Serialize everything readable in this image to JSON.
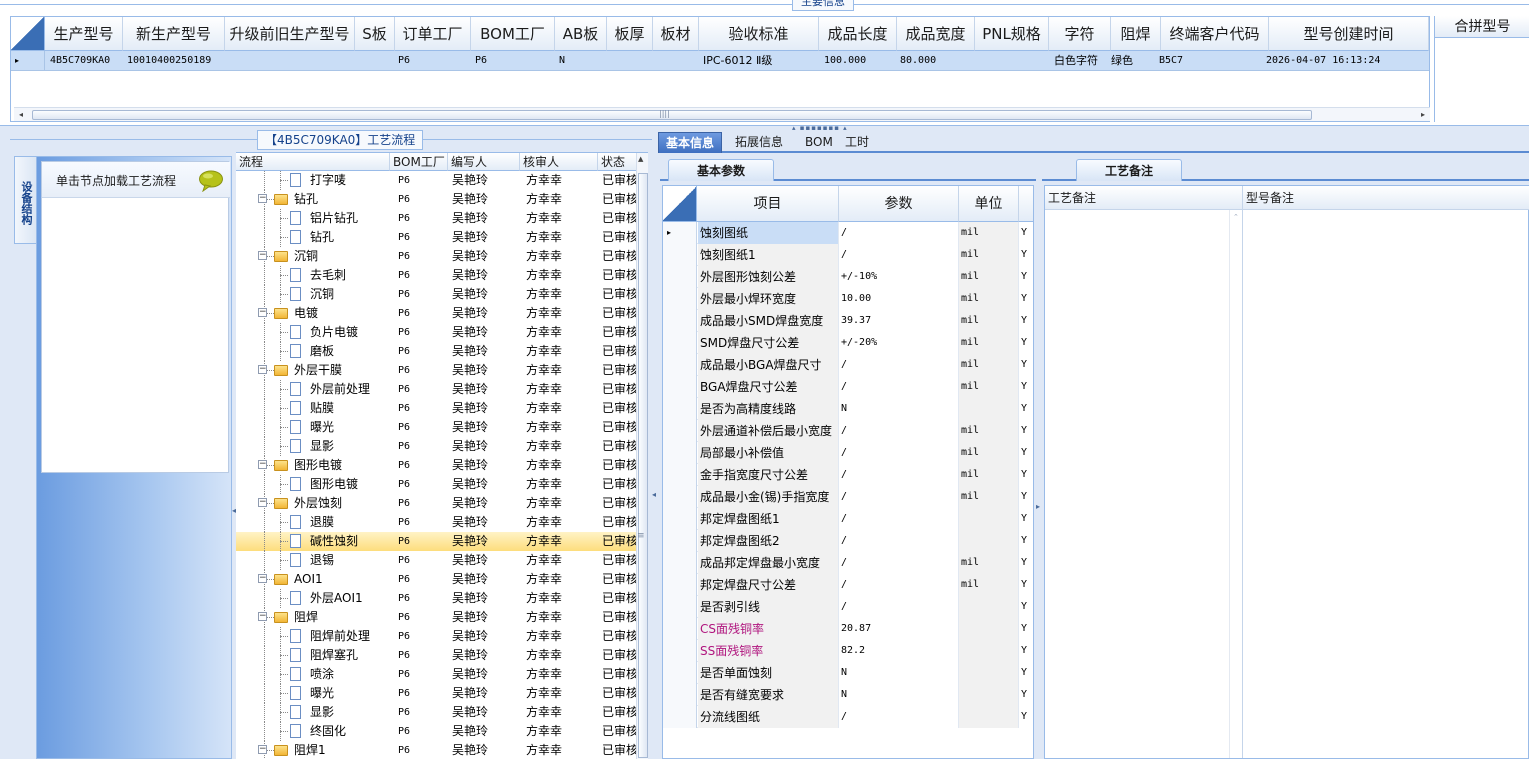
{
  "top": {
    "caption": "主要信息",
    "columns": [
      "生产型号",
      "新生产型号",
      "升级前旧生产型号",
      "S板",
      "订单工厂",
      "BOM工厂",
      "AB板",
      "板厚",
      "板材",
      "验收标准",
      "成品长度",
      "成品宽度",
      "PNL规格",
      "字符",
      "阻焊",
      "终端客户代码",
      "型号创建时间"
    ],
    "row": {
      "pointer": "▸",
      "model_no": "4B5C709KA0",
      "new_model_no": "10010400250189",
      "order_factory": "P6",
      "bom_factory": "P6",
      "ab_board": "N",
      "standard": "IPC-6012 Ⅱ级",
      "length": "100.000",
      "width": "80.000",
      "character": "白色字符",
      "solder_mask": "绿色",
      "customer_code": "B5C7",
      "created": "2026-04-07 16:13:24"
    },
    "combo_title": "合拼型号",
    "scroll_left": "◂",
    "scroll_right": "▸",
    "grip": "||||"
  },
  "splitter_grip": "▴ ▪▪▪▪▪▪▪ ▴",
  "left": {
    "process_title": "【4B5C709KA0】工艺流程",
    "vertical_tab": "设备结构",
    "node_hint": "单击节点加载工艺流程",
    "tree_columns": [
      "流程",
      "BOM工厂",
      "编写人",
      "核审人",
      "状态"
    ],
    "tree": [
      {
        "label": "打字唛",
        "level": 1,
        "kind": "file",
        "factory": "P6",
        "writer": "吴艳玲",
        "reviewer": "方幸幸",
        "status": "已审核"
      },
      {
        "label": "钻孔",
        "level": 0,
        "kind": "folder",
        "factory": "P6",
        "writer": "吴艳玲",
        "reviewer": "方幸幸",
        "status": "已审核"
      },
      {
        "label": "铝片钻孔",
        "level": 1,
        "kind": "file",
        "factory": "P6",
        "writer": "吴艳玲",
        "reviewer": "方幸幸",
        "status": "已审核"
      },
      {
        "label": "钻孔",
        "level": 1,
        "kind": "file",
        "factory": "P6",
        "writer": "吴艳玲",
        "reviewer": "方幸幸",
        "status": "已审核"
      },
      {
        "label": "沉铜",
        "level": 0,
        "kind": "folder",
        "factory": "P6",
        "writer": "吴艳玲",
        "reviewer": "方幸幸",
        "status": "已审核"
      },
      {
        "label": "去毛刺",
        "level": 1,
        "kind": "file",
        "factory": "P6",
        "writer": "吴艳玲",
        "reviewer": "方幸幸",
        "status": "已审核"
      },
      {
        "label": "沉铜",
        "level": 1,
        "kind": "file",
        "factory": "P6",
        "writer": "吴艳玲",
        "reviewer": "方幸幸",
        "status": "已审核"
      },
      {
        "label": "电镀",
        "level": 0,
        "kind": "folder",
        "factory": "P6",
        "writer": "吴艳玲",
        "reviewer": "方幸幸",
        "status": "已审核"
      },
      {
        "label": "负片电镀",
        "level": 1,
        "kind": "file",
        "factory": "P6",
        "writer": "吴艳玲",
        "reviewer": "方幸幸",
        "status": "已审核"
      },
      {
        "label": "磨板",
        "level": 1,
        "kind": "file",
        "factory": "P6",
        "writer": "吴艳玲",
        "reviewer": "方幸幸",
        "status": "已审核"
      },
      {
        "label": "外层干膜",
        "level": 0,
        "kind": "folder",
        "factory": "P6",
        "writer": "吴艳玲",
        "reviewer": "方幸幸",
        "status": "已审核"
      },
      {
        "label": "外层前处理",
        "level": 1,
        "kind": "file",
        "factory": "P6",
        "writer": "吴艳玲",
        "reviewer": "方幸幸",
        "status": "已审核"
      },
      {
        "label": "贴膜",
        "level": 1,
        "kind": "file",
        "factory": "P6",
        "writer": "吴艳玲",
        "reviewer": "方幸幸",
        "status": "已审核"
      },
      {
        "label": "曝光",
        "level": 1,
        "kind": "file",
        "factory": "P6",
        "writer": "吴艳玲",
        "reviewer": "方幸幸",
        "status": "已审核"
      },
      {
        "label": "显影",
        "level": 1,
        "kind": "file",
        "factory": "P6",
        "writer": "吴艳玲",
        "reviewer": "方幸幸",
        "status": "已审核"
      },
      {
        "label": "图形电镀",
        "level": 0,
        "kind": "folder",
        "factory": "P6",
        "writer": "吴艳玲",
        "reviewer": "方幸幸",
        "status": "已审核"
      },
      {
        "label": "图形电镀",
        "level": 1,
        "kind": "file",
        "factory": "P6",
        "writer": "吴艳玲",
        "reviewer": "方幸幸",
        "status": "已审核"
      },
      {
        "label": "外层蚀刻",
        "level": 0,
        "kind": "folder",
        "factory": "P6",
        "writer": "吴艳玲",
        "reviewer": "方幸幸",
        "status": "已审核"
      },
      {
        "label": "退膜",
        "level": 1,
        "kind": "file",
        "factory": "P6",
        "writer": "吴艳玲",
        "reviewer": "方幸幸",
        "status": "已审核"
      },
      {
        "label": "碱性蚀刻",
        "level": 1,
        "kind": "file",
        "factory": "P6",
        "writer": "吴艳玲",
        "reviewer": "方幸幸",
        "status": "已审核",
        "selected": true
      },
      {
        "label": "退锡",
        "level": 1,
        "kind": "file",
        "factory": "P6",
        "writer": "吴艳玲",
        "reviewer": "方幸幸",
        "status": "已审核"
      },
      {
        "label": "AOI1",
        "level": 0,
        "kind": "folder",
        "factory": "P6",
        "writer": "吴艳玲",
        "reviewer": "方幸幸",
        "status": "已审核"
      },
      {
        "label": "外层AOI1",
        "level": 1,
        "kind": "file",
        "factory": "P6",
        "writer": "吴艳玲",
        "reviewer": "方幸幸",
        "status": "已审核"
      },
      {
        "label": "阻焊",
        "level": 0,
        "kind": "folder",
        "factory": "P6",
        "writer": "吴艳玲",
        "reviewer": "方幸幸",
        "status": "已审核"
      },
      {
        "label": "阻焊前处理",
        "level": 1,
        "kind": "file",
        "factory": "P6",
        "writer": "吴艳玲",
        "reviewer": "方幸幸",
        "status": "已审核"
      },
      {
        "label": "阻焊塞孔",
        "level": 1,
        "kind": "file",
        "factory": "P6",
        "writer": "吴艳玲",
        "reviewer": "方幸幸",
        "status": "已审核"
      },
      {
        "label": "喷涂",
        "level": 1,
        "kind": "file",
        "factory": "P6",
        "writer": "吴艳玲",
        "reviewer": "方幸幸",
        "status": "已审核"
      },
      {
        "label": "曝光",
        "level": 1,
        "kind": "file",
        "factory": "P6",
        "writer": "吴艳玲",
        "reviewer": "方幸幸",
        "status": "已审核"
      },
      {
        "label": "显影",
        "level": 1,
        "kind": "file",
        "factory": "P6",
        "writer": "吴艳玲",
        "reviewer": "方幸幸",
        "status": "已审核"
      },
      {
        "label": "终固化",
        "level": 1,
        "kind": "file",
        "factory": "P6",
        "writer": "吴艳玲",
        "reviewer": "方幸幸",
        "status": "已审核"
      },
      {
        "label": "阻焊1",
        "level": 0,
        "kind": "folder",
        "factory": "P6",
        "writer": "吴艳玲",
        "reviewer": "方幸幸",
        "status": "已审核"
      }
    ]
  },
  "right": {
    "tabs": [
      "基本信息",
      "拓展信息",
      "BOM",
      "工时"
    ],
    "active_tab": 0,
    "basic_subtab": "基本参数",
    "param_columns": [
      "项目",
      "参数",
      "单位"
    ],
    "params": [
      {
        "item": "蚀刻图纸",
        "value": "/",
        "unit": "mil",
        "flag": "Y",
        "selected": true
      },
      {
        "item": "蚀刻图纸1",
        "value": "/",
        "unit": "mil",
        "flag": "Y"
      },
      {
        "item": "外层图形蚀刻公差",
        "value": "+/-10%",
        "unit": "mil",
        "flag": "Y"
      },
      {
        "item": "外层最小焊环宽度",
        "value": "10.00",
        "unit": "mil",
        "flag": "Y"
      },
      {
        "item": "成品最小SMD焊盘宽度",
        "value": "39.37",
        "unit": "mil",
        "flag": "Y"
      },
      {
        "item": "SMD焊盘尺寸公差",
        "value": "+/-20%",
        "unit": "mil",
        "flag": "Y"
      },
      {
        "item": "成品最小BGA焊盘尺寸",
        "value": "/",
        "unit": "mil",
        "flag": "Y"
      },
      {
        "item": "BGA焊盘尺寸公差",
        "value": "/",
        "unit": "mil",
        "flag": "Y"
      },
      {
        "item": "是否为高精度线路",
        "value": "N",
        "unit": "",
        "flag": "Y"
      },
      {
        "item": "外层通道补偿后最小宽度",
        "value": "/",
        "unit": "mil",
        "flag": "Y"
      },
      {
        "item": "局部最小补偿值",
        "value": "/",
        "unit": "mil",
        "flag": "Y"
      },
      {
        "item": "金手指宽度尺寸公差",
        "value": "/",
        "unit": "mil",
        "flag": "Y"
      },
      {
        "item": "成品最小金(锡)手指宽度",
        "value": "/",
        "unit": "mil",
        "flag": "Y"
      },
      {
        "item": "邦定焊盘图纸1",
        "value": "/",
        "unit": "",
        "flag": "Y"
      },
      {
        "item": "邦定焊盘图纸2",
        "value": "/",
        "unit": "",
        "flag": "Y"
      },
      {
        "item": "成品邦定焊盘最小宽度",
        "value": "/",
        "unit": "mil",
        "flag": "Y"
      },
      {
        "item": "邦定焊盘尺寸公差",
        "value": "/",
        "unit": "mil",
        "flag": "Y"
      },
      {
        "item": "是否剥引线",
        "value": "/",
        "unit": "",
        "flag": "Y"
      },
      {
        "item": "CS面残铜率",
        "value": "20.87",
        "unit": "",
        "flag": "Y",
        "color": "magenta"
      },
      {
        "item": "SS面残铜率",
        "value": "82.2",
        "unit": "",
        "flag": "Y",
        "color": "magenta"
      },
      {
        "item": "是否单面蚀刻",
        "value": "N",
        "unit": "",
        "flag": "Y"
      },
      {
        "item": "是否有缝宽要求",
        "value": "N",
        "unit": "",
        "flag": "Y"
      },
      {
        "item": "分流线图纸",
        "value": "/",
        "unit": "",
        "flag": "Y"
      }
    ],
    "remark_subtab": "工艺备注",
    "process_remark": "工艺备注",
    "model_remark": "型号备注"
  },
  "colors": {
    "accent": "#5b8bd2",
    "selection": "#c9ddf6",
    "tree_selection": "#fddd7c",
    "magenta": "#b0157e"
  },
  "icons": [
    "chat-bubble-icon",
    "folder-icon",
    "file-icon",
    "expand-minus-icon",
    "row-pointer-icon"
  ]
}
